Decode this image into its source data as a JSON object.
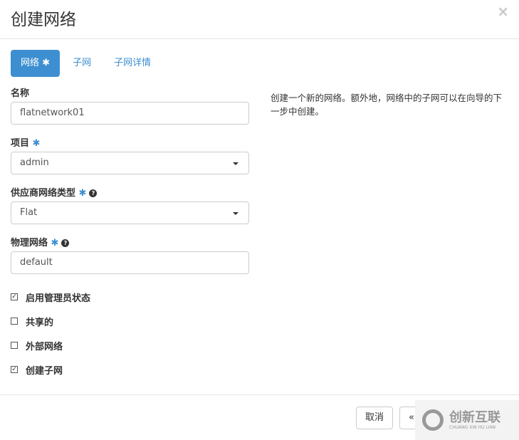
{
  "dialog": {
    "title": "创建网络",
    "close": "×"
  },
  "tabs": [
    {
      "label": "网络",
      "required": "✱"
    },
    {
      "label": "子网"
    },
    {
      "label": "子网详情"
    }
  ],
  "form": {
    "name": {
      "label": "名称",
      "value": "flatnetwork01"
    },
    "project": {
      "label": "项目",
      "required": "✱",
      "value": "admin"
    },
    "provider_type": {
      "label": "供应商网络类型",
      "required": "✱",
      "help": "?",
      "value": "Flat"
    },
    "physical_network": {
      "label": "物理网络",
      "required": "✱",
      "help": "?",
      "value": "default"
    },
    "checkboxes": [
      {
        "label": "启用管理员状态",
        "checked": true,
        "mark": "✓"
      },
      {
        "label": "共享的",
        "checked": false,
        "mark": ""
      },
      {
        "label": "外部网络",
        "checked": false,
        "mark": ""
      },
      {
        "label": "创建子网",
        "checked": true,
        "mark": "✓"
      }
    ]
  },
  "description": "创建一个新的网络。额外地，网络中的子网可以在向导的下一步中创建。",
  "footer": {
    "cancel": "取消",
    "back": "«"
  },
  "watermark": {
    "title": "创新互联",
    "subtitle": "CHUANG XIN HU LIAN"
  }
}
